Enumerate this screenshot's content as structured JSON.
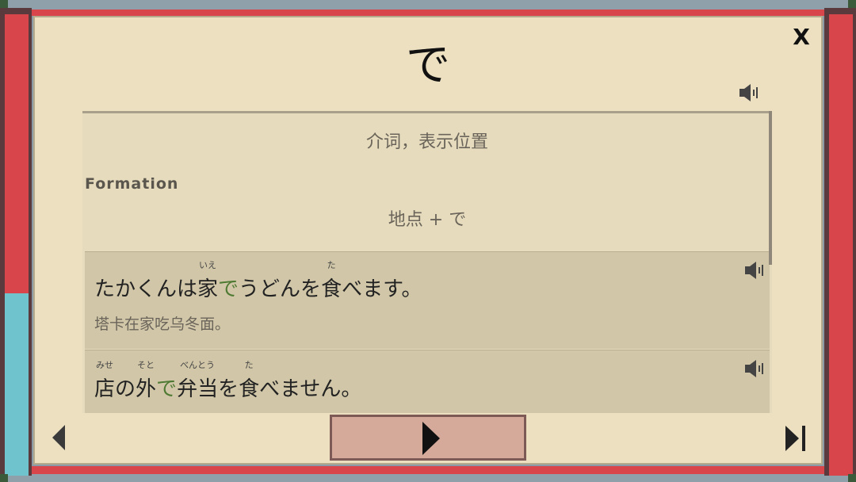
{
  "window": {
    "close_label": "X"
  },
  "grammar": {
    "title": "で",
    "meaning": "介词，表示位置",
    "formation_label": "Formation",
    "formation": "地点 + で"
  },
  "examples": [
    {
      "pre": "たかくんは",
      "kanji1": "家",
      "kanji1_reading": "いえ",
      "particle": "で",
      "mid": "うどんを",
      "kanji2": "食",
      "kanji2_reading": "た",
      "post": "べます。",
      "translation": "塔卡在家吃乌冬面。"
    },
    {
      "kanji1": "店",
      "kanji1_reading": "みせ",
      "mid1": "の",
      "kanji2": "外",
      "kanji2_reading": "そと",
      "particle": "で",
      "kanji3": "弁当",
      "kanji3_reading": "べんとう",
      "mid2": "を",
      "kanji4": "食",
      "kanji4_reading": "た",
      "post": "べません。"
    }
  ],
  "icons": {
    "speaker": "speaker-icon",
    "prev": "chevron-left-icon",
    "play": "play-icon",
    "skip": "skip-end-icon"
  },
  "colors": {
    "accent_particle": "#4f7a33",
    "frame_red": "#d8464b",
    "panel_bg": "#ece0c0"
  }
}
